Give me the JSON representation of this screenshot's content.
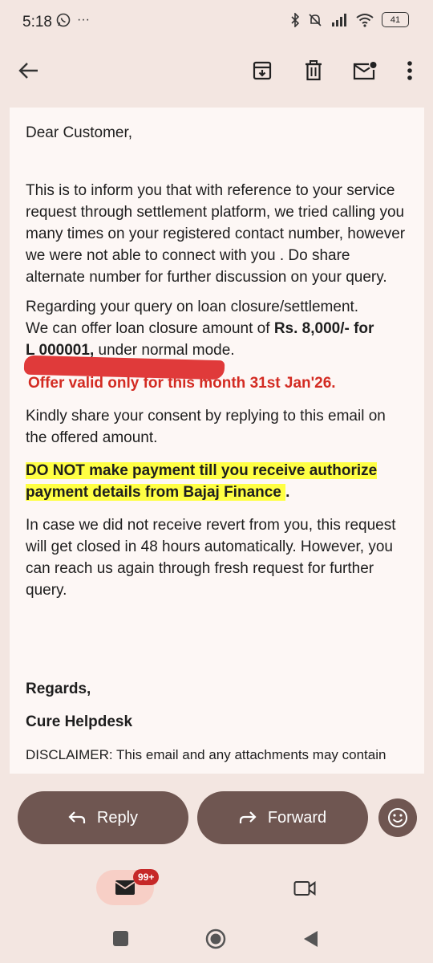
{
  "status_bar": {
    "time": "5:18",
    "more": "···",
    "battery": "41"
  },
  "email": {
    "greeting": "Dear Customer,",
    "para1": "This is to inform you that with reference to your service request through settlement platform, we tried calling you many times on your registered contact number, however we were not able to connect with you . Do share alternate number for further discussion on your query.",
    "para2_a": " Regarding your query on loan closure/settlement.",
    "para2_b": "We can offer loan closure amount of ",
    "para2_amount": "Rs. 8,000/- for",
    "para2_account": "L            000001,",
    "para2_mode": " under normal mode.",
    "offer": "Offer valid only for this month 31st Jan'26.",
    "consent": " Kindly share your consent by replying to this email on the offered amount.",
    "warning": " DO NOT make payment till you receive authorize payment details from  Bajaj Finance ",
    "warning_end": ".",
    "closing": " In case we did not receive revert from you, this request will get closed in 48 hours automatically. However, you can reach us again through fresh request for further query.",
    "regards": "Regards,",
    "signature": "Cure Helpdesk",
    "disclaimer": "DISCLAIMER: This email and any attachments may contain"
  },
  "actions": {
    "reply": "Reply",
    "forward": "Forward"
  },
  "bottom_nav": {
    "mail_badge": "99+"
  },
  "colors": {
    "accent_button": "#6f5651",
    "background": "#f3e6e1",
    "offer_red": "#d32b22",
    "highlight": "#ffff44"
  }
}
